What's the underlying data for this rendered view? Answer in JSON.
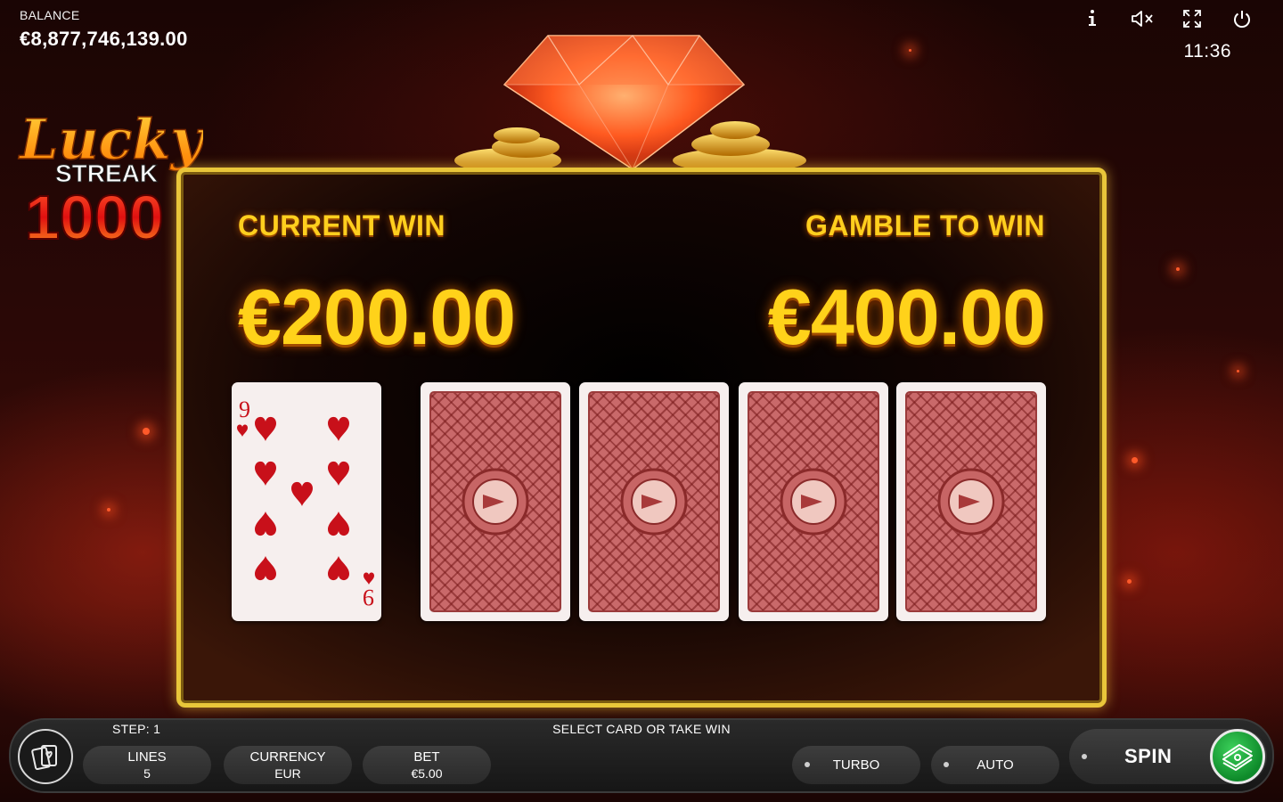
{
  "header": {
    "balance_label": "BALANCE",
    "balance_value": "€8,877,746,139.00",
    "clock": "11:36",
    "icons": [
      "info-icon",
      "sound-muted-icon",
      "fullscreen-icon",
      "power-icon"
    ]
  },
  "logo": {
    "line1": "Lucky",
    "line2": "STREAK",
    "line3": "1000"
  },
  "gamble": {
    "current_win_label": "CURRENT WIN",
    "current_win_value": "€200.00",
    "gamble_label": "GAMBLE TO WIN",
    "gamble_value": "€400.00",
    "dealer_card": {
      "rank": "9",
      "suit": "hearts"
    },
    "hidden_cards": 4
  },
  "controls": {
    "step": "STEP: 1",
    "message": "SELECT CARD OR TAKE WIN",
    "lines_label": "LINES",
    "lines_value": "5",
    "currency_label": "CURRENCY",
    "currency_value": "EUR",
    "bet_label": "BET",
    "bet_value": "€5.00",
    "turbo_label": "TURBO",
    "auto_label": "AUTO",
    "spin_label": "SPIN"
  },
  "colors": {
    "gold": "#ffd21a",
    "frame": "#e9c63a",
    "card_red": "#c8101a",
    "card_back": "#c9696a",
    "take_win_green": "#1fae43"
  }
}
